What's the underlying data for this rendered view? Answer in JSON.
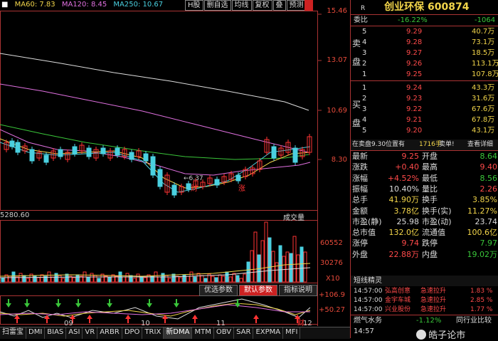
{
  "ma_legend": {
    "ma60": "MA60: 7.83",
    "ma120": "MA120: 8.45",
    "ma250": "MA250: 10.67"
  },
  "toolbar": [
    "H股",
    "删自选",
    "均线",
    "复权",
    "叠",
    "预测"
  ],
  "price_axis": [
    "15.46",
    "13.07",
    "10.69",
    "8.30"
  ],
  "chart_annotations": {
    "low": "6.37",
    "cai1": "财",
    "zhang": "涨",
    "cai2": "财"
  },
  "volume_head": {
    "left": "5280.60",
    "label": "成交量"
  },
  "volume_axis": [
    "60552",
    "30276",
    "X10"
  ],
  "indicator_axis": [
    "+106.9",
    "+50.27"
  ],
  "months": [
    "09",
    "10",
    "11",
    "12"
  ],
  "indicator_buttons": [
    "优选参数",
    "默认参数",
    "指标说明"
  ],
  "tabs": [
    "扫雷宝",
    "DMI",
    "BIAS",
    "ASI",
    "VR",
    "ARBR",
    "DPO",
    "TRIX",
    "新DMA",
    "MTM",
    "OBV",
    "SAR",
    "EXPMA",
    "MFI"
  ],
  "quote": {
    "name": "创业环保",
    "code": "600874",
    "r": "R",
    "webi_label": "委比",
    "webi_val": "-16.22%",
    "weicha_val": "-1064",
    "sell_side_label": [
      "卖",
      "盘"
    ],
    "buy_side_label": [
      "买",
      "盘"
    ],
    "sell": [
      {
        "n": "5",
        "p": "9.29",
        "v": "40.7万"
      },
      {
        "n": "4",
        "p": "9.28",
        "v": "73.1万"
      },
      {
        "n": "3",
        "p": "9.27",
        "v": "18.5万"
      },
      {
        "n": "2",
        "p": "9.26",
        "v": "113.1万"
      },
      {
        "n": "1",
        "p": "9.25",
        "v": "107.8万"
      }
    ],
    "buy": [
      {
        "n": "1",
        "p": "9.24",
        "v": "43.3万"
      },
      {
        "n": "2",
        "p": "9.23",
        "v": "31.6万"
      },
      {
        "n": "3",
        "p": "9.22",
        "v": "67.6万"
      },
      {
        "n": "4",
        "p": "9.21",
        "v": "67.8万"
      },
      {
        "n": "5",
        "p": "9.20",
        "v": "43.1万"
      }
    ],
    "sell_note": "在卖盘9.30位置有",
    "sell_note_vol": "1716手",
    "sell_note_tail": "卖单!",
    "sell_note_link": "查看详细",
    "stats": [
      [
        "最新",
        "9.25",
        "red",
        "开盘",
        "8.64",
        "green"
      ],
      [
        "涨跌",
        "+0.40",
        "red",
        "最高",
        "9.40",
        "red"
      ],
      [
        "涨幅",
        "+4.52%",
        "red",
        "最低",
        "8.56",
        "green"
      ],
      [
        "振幅",
        "10.40%",
        "white",
        "量比",
        "2.26",
        "red"
      ],
      [
        "总手",
        "41.90万",
        "yellow",
        "换手",
        "3.85%",
        "yellow"
      ],
      [
        "金额",
        "3.78亿",
        "yellow",
        "换手(实)",
        "11.27%",
        "yellow"
      ],
      [
        "市盈(静)",
        "25.98",
        "white",
        "市盈(动)",
        "23.74",
        "white"
      ],
      [
        "总市值",
        "132.0亿",
        "yellow",
        "流通值",
        "100.6亿",
        "yellow"
      ],
      [
        "涨停",
        "9.74",
        "red",
        "跌停",
        "7.97",
        "green"
      ],
      [
        "外盘",
        "22.88万",
        "red",
        "内盘",
        "19.02万",
        "green"
      ]
    ],
    "jingling_title": "短线精灵",
    "jingling": [
      {
        "t": "14:57:00",
        "name": "弘高创意",
        "ev": "急速拉升",
        "pct": "1.83 %"
      },
      {
        "t": "14:57:00",
        "name": "金宇车城",
        "ev": "急速拉升",
        "pct": "2.85 %"
      },
      {
        "t": "14:57:00",
        "name": "兴业股份",
        "ev": "急速拉升",
        "pct": "1.77 %"
      }
    ],
    "sector_name": "燃气水务",
    "sector_pct": "-1.12%",
    "sector_link": "同行业比较",
    "ticks": [
      {
        "t": "14:57",
        "p": "",
        "v": ""
      },
      {
        "t": "15:00",
        "p": "9.25",
        "v": "508.7万"
      }
    ],
    "watermark": "皓子论市",
    "bottom_tabs": [
      "细",
      "分",
      "笔"
    ]
  }
}
